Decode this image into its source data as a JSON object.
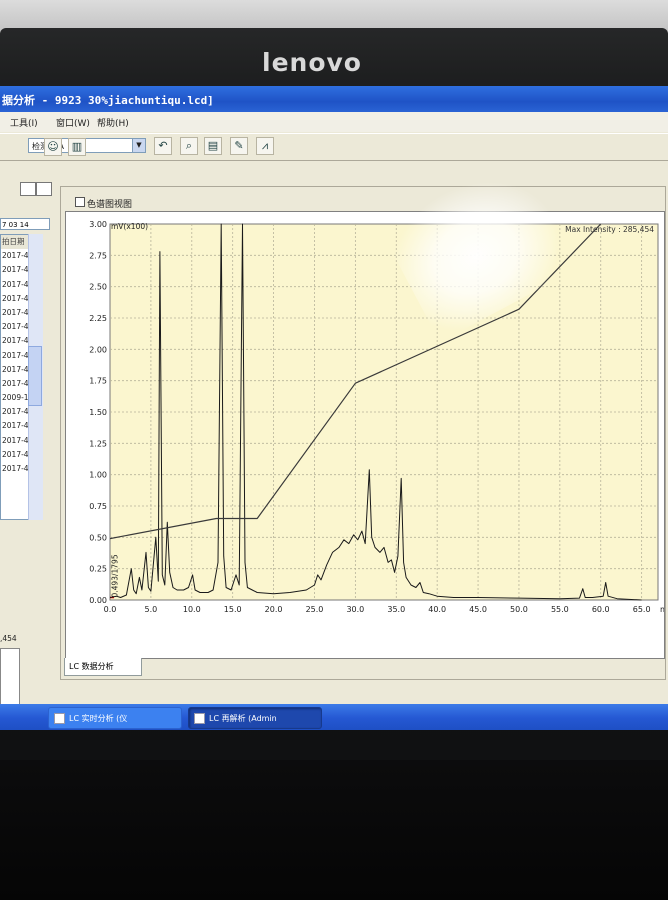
{
  "monitor": {
    "brand": "lenovo"
  },
  "window": {
    "title": "据分析 - 9923 30%jiachuntiqu.lcd]"
  },
  "menu": [
    "工具(I)",
    "窗口(W)",
    "帮助(H)"
  ],
  "toolbar": {
    "detector_select": "检测器 A"
  },
  "left_panel": {
    "date_field": "7 03 14",
    "list_header": "拍日期",
    "list_items": [
      "2017-4",
      "2017-4",
      "2017-4",
      "2017-4",
      "2017-4",
      "2017-4",
      "2017-4",
      "2017-4",
      "2017-4",
      "2017-4",
      "2009-1",
      "2017-4",
      "2017-4",
      "2017-4",
      "2017-4",
      "2017-4"
    ],
    "max_value": ",454"
  },
  "chart_panel": {
    "title": "色谱图视图",
    "max_intensity": "Max Intensity : 285,454",
    "y_unit": "mV(x100)",
    "peak_label": "0.493/1795",
    "bottom_tab": "LC 数据分析"
  },
  "taskbar": {
    "task1": "LC 实时分析 (仪",
    "task2": "LC 再解析 (Admin"
  },
  "chart_data": {
    "type": "line",
    "xlabel": "min",
    "ylabel": "mV(x100)",
    "xlim": [
      0,
      67
    ],
    "ylim": [
      0,
      3.0
    ],
    "x_ticks": [
      "0.0",
      "5.0",
      "10.0",
      "15.0",
      "20.0",
      "25.0",
      "30.0",
      "35.0",
      "40.0",
      "45.0",
      "50.0",
      "55.0",
      "60.0",
      "65.0"
    ],
    "y_ticks": [
      "0.00",
      "0.25",
      "0.50",
      "0.75",
      "1.00",
      "1.25",
      "1.50",
      "1.75",
      "2.00",
      "2.25",
      "2.50",
      "2.75",
      "3.00"
    ],
    "grid": true,
    "series": [
      {
        "points": [
          [
            0,
            0.02
          ],
          [
            0.8,
            0.03
          ],
          [
            1.3,
            0.02
          ],
          [
            2.0,
            0.04
          ],
          [
            2.6,
            0.25
          ],
          [
            2.9,
            0.08
          ],
          [
            3.2,
            0.05
          ],
          [
            3.6,
            0.18
          ],
          [
            3.9,
            0.08
          ],
          [
            4.4,
            0.38
          ],
          [
            4.7,
            0.1
          ],
          [
            5.0,
            0.07
          ],
          [
            5.6,
            0.5
          ],
          [
            5.9,
            0.15
          ],
          [
            6.1,
            2.78
          ],
          [
            6.4,
            0.2
          ],
          [
            6.7,
            0.12
          ],
          [
            7.0,
            0.62
          ],
          [
            7.3,
            0.22
          ],
          [
            7.7,
            0.1
          ],
          [
            8.2,
            0.08
          ],
          [
            9.0,
            0.08
          ],
          [
            9.6,
            0.1
          ],
          [
            10.1,
            0.2
          ],
          [
            10.4,
            0.08
          ],
          [
            11.0,
            0.06
          ],
          [
            12.0,
            0.06
          ],
          [
            12.6,
            0.08
          ],
          [
            13.2,
            0.3
          ],
          [
            13.6,
            3.0
          ],
          [
            13.9,
            0.35
          ],
          [
            14.2,
            0.1
          ],
          [
            14.8,
            0.08
          ],
          [
            15.4,
            0.2
          ],
          [
            15.8,
            0.12
          ],
          [
            16.2,
            3.0
          ],
          [
            16.5,
            0.3
          ],
          [
            16.8,
            0.1
          ],
          [
            17.4,
            0.08
          ],
          [
            18.0,
            0.06
          ],
          [
            20.0,
            0.05
          ],
          [
            22.0,
            0.06
          ],
          [
            24.0,
            0.08
          ],
          [
            25.0,
            0.12
          ],
          [
            25.4,
            0.2
          ],
          [
            25.8,
            0.16
          ],
          [
            26.5,
            0.28
          ],
          [
            27.2,
            0.38
          ],
          [
            28.0,
            0.42
          ],
          [
            28.6,
            0.48
          ],
          [
            29.2,
            0.45
          ],
          [
            29.8,
            0.52
          ],
          [
            30.3,
            0.48
          ],
          [
            30.8,
            0.55
          ],
          [
            31.2,
            0.45
          ],
          [
            31.7,
            1.04
          ],
          [
            32.0,
            0.5
          ],
          [
            32.4,
            0.42
          ],
          [
            33.0,
            0.38
          ],
          [
            33.5,
            0.42
          ],
          [
            34.0,
            0.3
          ],
          [
            34.4,
            0.32
          ],
          [
            34.8,
            0.22
          ],
          [
            35.2,
            0.35
          ],
          [
            35.6,
            0.97
          ],
          [
            35.9,
            0.3
          ],
          [
            36.2,
            0.18
          ],
          [
            36.8,
            0.12
          ],
          [
            37.4,
            0.1
          ],
          [
            37.9,
            0.14
          ],
          [
            38.3,
            0.06
          ],
          [
            39.0,
            0.05
          ],
          [
            40.0,
            0.03
          ],
          [
            42.0,
            0.02
          ],
          [
            45.0,
            0.02
          ],
          [
            50.0,
            0.015
          ],
          [
            55.0,
            0.01
          ],
          [
            57.4,
            0.015
          ],
          [
            57.8,
            0.09
          ],
          [
            58.1,
            0.02
          ],
          [
            59.0,
            0.02
          ],
          [
            60.3,
            0.03
          ],
          [
            60.6,
            0.14
          ],
          [
            60.9,
            0.03
          ],
          [
            62.0,
            0.01
          ],
          [
            65.0,
            0.0
          ]
        ]
      },
      {
        "points": [
          [
            0,
            0.49
          ],
          [
            13.0,
            0.65
          ],
          [
            18.0,
            0.65
          ],
          [
            30.0,
            1.73
          ],
          [
            50.0,
            2.32
          ],
          [
            60.0,
            3.0
          ]
        ]
      }
    ]
  }
}
